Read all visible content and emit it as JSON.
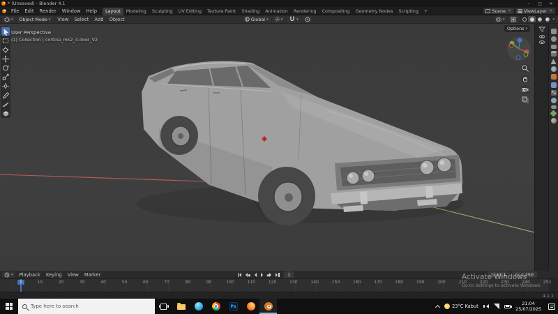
{
  "window": {
    "title": "* (Unsaved) - Blender 4.1",
    "controls": {
      "minimize": "–",
      "maximize": "□",
      "close": "×"
    }
  },
  "topbar": {
    "menus": [
      "File",
      "Edit",
      "Render",
      "Window",
      "Help"
    ],
    "workspaces": [
      "Layout",
      "Modeling",
      "Sculpting",
      "UV Editing",
      "Texture Paint",
      "Shading",
      "Animation",
      "Rendering",
      "Compositing",
      "Geometry Nodes",
      "Scripting",
      "+"
    ],
    "active_workspace": "Layout",
    "scene": "Scene",
    "view_layer": "ViewLayer"
  },
  "tool_header": {
    "mode": "Object Mode",
    "menus": [
      "View",
      "Select",
      "Add",
      "Object"
    ],
    "orientation": "Global",
    "icons": [
      "editor-type-icon",
      "transform-orientation-icon",
      "pivot-point-icon",
      "snap-magnet-icon",
      "proportional-editing-icon",
      "overlays-icon",
      "xray-icon",
      "shading-wireframe-icon",
      "shading-solid-icon",
      "shading-material-icon",
      "shading-rendered-icon"
    ]
  },
  "viewport": {
    "view_label": "User Perspective",
    "collection_label": "(1) Collection | cortina_mk2_4-door_V2",
    "options_label": "Options",
    "tools": [
      "tweak",
      "select-box",
      "cursor",
      "move",
      "rotate",
      "scale",
      "transform",
      "annotate",
      "measure",
      "add-cube"
    ],
    "nav_icons": [
      "zoom-icon",
      "pan-hand-icon",
      "camera-view-icon",
      "perspective-toggle-icon"
    ],
    "object_name": "cortina_mk2_4-door_V2"
  },
  "right_rail": {
    "outliner_icons": [
      "filter-icon",
      "eye-icon",
      "eye-icon"
    ],
    "properties_tabs": [
      "tool",
      "render",
      "output",
      "view-layer",
      "scene",
      "world",
      "object",
      "modifiers",
      "particles",
      "physics",
      "constraints",
      "object-data",
      "material"
    ]
  },
  "timeline": {
    "menus": [
      "Playback",
      "Keying",
      "View",
      "Marker"
    ],
    "transport": [
      "jump-to-start",
      "prev-keyframe",
      "play-reverse",
      "play",
      "next-keyframe",
      "jump-to-end"
    ],
    "current_frame": "1",
    "start_label": "Start",
    "start_value": "1",
    "end_label": "End",
    "end_value": "250",
    "ticks": [
      10,
      20,
      30,
      40,
      50,
      60,
      70,
      80,
      90,
      100,
      110,
      120,
      130,
      140,
      150,
      160,
      170,
      180,
      190,
      200,
      210,
      220,
      230,
      240,
      250
    ]
  },
  "status": {
    "version": "4.1.1"
  },
  "watermark": {
    "line1": "Activate Windows",
    "line2": "Go to Settings to activate Windows."
  },
  "taskbar": {
    "search_placeholder": "Type here to search",
    "apps": [
      "task-view",
      "file-explorer",
      "edge",
      "chrome",
      "photoshop",
      "firefox",
      "blender"
    ],
    "active_app": "blender",
    "photoshop_label": "Ps",
    "tray": {
      "weather": "23°C Kabut",
      "time": "21:04",
      "date": "25/07/2025"
    }
  },
  "colors": {
    "accent": "#4772b3",
    "axis_x": "#b85c5c",
    "axis_y": "#a0a468",
    "viewport_bg": "#3c3c3c",
    "car_body": "#a0a0a0"
  }
}
